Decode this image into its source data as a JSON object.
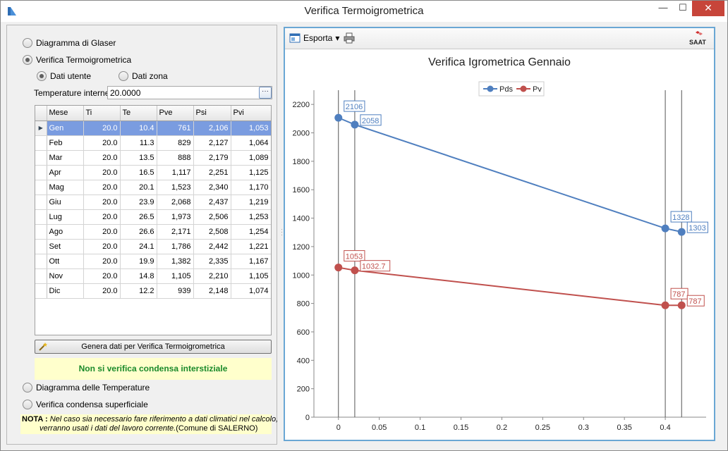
{
  "window": {
    "title": "Verifica Termoigrometrica",
    "minimize": "—",
    "maximize": "☐",
    "close": "✕"
  },
  "left": {
    "radios": [
      {
        "label": "Diagramma di Glaser",
        "checked": false
      },
      {
        "label": "Verifica Termoigrometrica",
        "checked": true
      }
    ],
    "sub_radios": [
      {
        "label": "Dati utente",
        "checked": true
      },
      {
        "label": "Dati zona",
        "checked": false
      }
    ],
    "temp_label": "Temperature interne",
    "temp_value": "20.0000",
    "temp_button": "···",
    "table": {
      "columns": [
        "Mese",
        "Ti",
        "Te",
        "Pve",
        "Psi",
        "Pvi"
      ],
      "selected_row": 0,
      "row_marker": "▶",
      "rows": [
        [
          "Gen",
          "20.0",
          "10.4",
          "761",
          "2,106",
          "1,053"
        ],
        [
          "Feb",
          "20.0",
          "11.3",
          "829",
          "2,127",
          "1,064"
        ],
        [
          "Mar",
          "20.0",
          "13.5",
          "888",
          "2,179",
          "1,089"
        ],
        [
          "Apr",
          "20.0",
          "16.5",
          "1,117",
          "2,251",
          "1,125"
        ],
        [
          "Mag",
          "20.0",
          "20.1",
          "1,523",
          "2,340",
          "1,170"
        ],
        [
          "Giu",
          "20.0",
          "23.9",
          "2,068",
          "2,437",
          "1,219"
        ],
        [
          "Lug",
          "20.0",
          "26.5",
          "1,973",
          "2,506",
          "1,253"
        ],
        [
          "Ago",
          "20.0",
          "26.6",
          "2,171",
          "2,508",
          "1,254"
        ],
        [
          "Set",
          "20.0",
          "24.1",
          "1,786",
          "2,442",
          "1,221"
        ],
        [
          "Ott",
          "20.0",
          "19.9",
          "1,382",
          "2,335",
          "1,167"
        ],
        [
          "Nov",
          "20.0",
          "14.8",
          "1,105",
          "2,210",
          "1,105"
        ],
        [
          "Dic",
          "20.0",
          "12.2",
          "939",
          "2,148",
          "1,074"
        ]
      ]
    },
    "generate_button": "Genera dati per Verifica Termoigrometrica",
    "result_text": "Non si verifica condensa interstiziale",
    "radios_bottom": [
      {
        "label": "Diagramma delle Temperature",
        "checked": false
      },
      {
        "label": "Verifica condensa superficiale",
        "checked": false
      }
    ],
    "nota": {
      "label": "NOTA :",
      "line1": "Nel caso sia necessario fare riferimento a dati climatici nel calcolo,",
      "line2_italic": "verranno usati i dati del lavoro corrente.",
      "line2_plain": "(Comune di SALERNO)"
    }
  },
  "toolbar": {
    "export_label": "Esporta",
    "export_arrow": "▾",
    "logo_text": "SAAT"
  },
  "chart_data": {
    "type": "line",
    "title": "Verifica Igrometrica Gennaio",
    "xlabel": "",
    "ylabel": "",
    "xlim": [
      -0.03,
      0.45
    ],
    "ylim": [
      0,
      2300
    ],
    "xticks": [
      0,
      0.05,
      0.1,
      0.15,
      0.2,
      0.25,
      0.3,
      0.35,
      0.4
    ],
    "xtick_labels": [
      "0",
      "0.05",
      "0.1",
      "0.15",
      "0.2",
      "0.25",
      "0.3",
      "0.35",
      "0.4"
    ],
    "yticks": [
      0,
      200,
      400,
      600,
      800,
      1000,
      1200,
      1400,
      1600,
      1800,
      2000,
      2200
    ],
    "vertical_lines": [
      0,
      0.02,
      0.4,
      0.42
    ],
    "grid": false,
    "legend_position": "top-center",
    "series": [
      {
        "name": "Pds",
        "color": "#4f7fbf",
        "x": [
          0,
          0.02,
          0.4,
          0.42
        ],
        "y": [
          2106,
          2058,
          1328,
          1303
        ],
        "labels": [
          "2106",
          "2058",
          "1328",
          "1303"
        ]
      },
      {
        "name": "Pv",
        "color": "#c0504d",
        "x": [
          0,
          0.02,
          0.4,
          0.42
        ],
        "y": [
          1053,
          1032.7,
          787,
          787
        ],
        "labels": [
          "1053",
          "1032.7",
          "787",
          "787"
        ]
      }
    ]
  }
}
